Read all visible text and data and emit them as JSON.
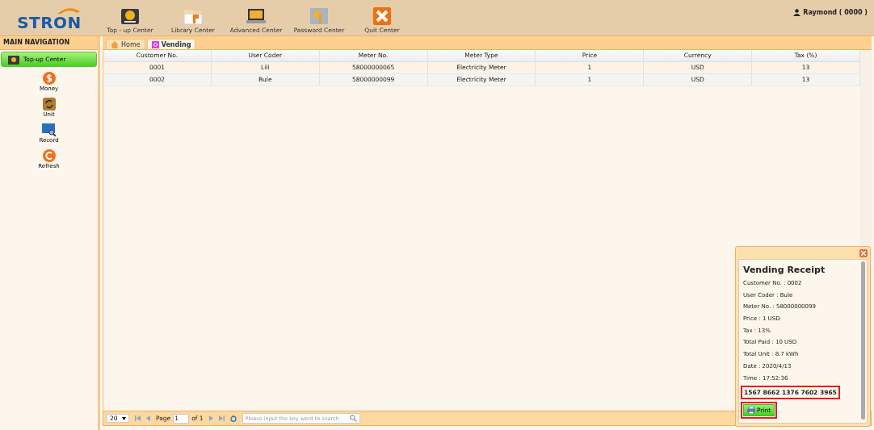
{
  "header": {
    "logo": "STRON",
    "toolbar": [
      {
        "label": "Top - up Center",
        "kind": "topup"
      },
      {
        "label": "Library Center",
        "kind": "library"
      },
      {
        "label": "Advanced Center",
        "kind": "advanced"
      },
      {
        "label": "Password Center",
        "kind": "password"
      },
      {
        "label": "Quit Center",
        "kind": "quit"
      }
    ],
    "user": "Raymond ( 0000 )"
  },
  "sidebar": {
    "title": "MAIN NAVIGATION",
    "section": {
      "label": "Top-up Center",
      "selected": true
    },
    "items": [
      {
        "label": "Money",
        "kind": "money"
      },
      {
        "label": "Unit",
        "kind": "unit"
      },
      {
        "label": "Record",
        "kind": "record"
      },
      {
        "label": "Refresh",
        "kind": "refresh"
      }
    ]
  },
  "tabs": [
    {
      "label": "Home",
      "kind": "home",
      "selected": false
    },
    {
      "label": "Vending",
      "kind": "vending",
      "selected": true
    }
  ],
  "table": {
    "columns": [
      "Customer No.",
      "User Coder",
      "Meter No.",
      "Meter Type",
      "Price",
      "Currency",
      "Tax (%)"
    ],
    "rows": [
      [
        "0001",
        "Lili",
        "58000000065",
        "Electricity Meter",
        "1",
        "USD",
        "13"
      ],
      [
        "0002",
        "Bule",
        "58000000099",
        "Electricity Meter",
        "1",
        "USD",
        "13"
      ]
    ]
  },
  "pager": {
    "page_size": "20",
    "page_label": "Page",
    "page": "1",
    "of": "of 1",
    "search_placeholder": "Please input the key word to search"
  },
  "receipt": {
    "title": "Vending Receipt",
    "lines": [
      "Customer No. : 0002",
      "User Coder : Bule",
      "Meter No. : 58000000099",
      "Price : 1 USD",
      "Tax : 13%",
      "Total Paid : 10 USD",
      "Total Unit : 8.7 kWh",
      "Date : 2020/4/13",
      "Time : 17:52:36"
    ],
    "token": "1567 8662 1376 7602 3965",
    "print": "Print"
  }
}
